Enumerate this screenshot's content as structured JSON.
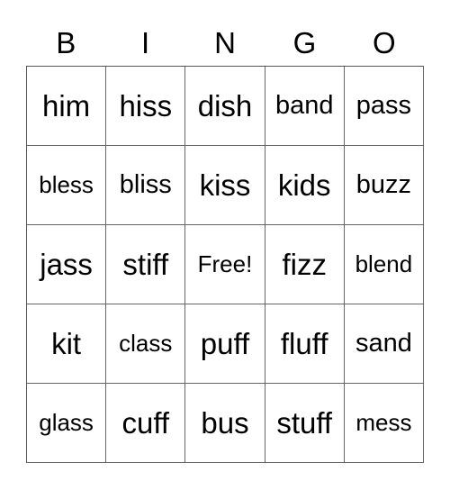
{
  "header": [
    "B",
    "I",
    "N",
    "G",
    "O"
  ],
  "cells": [
    [
      "him",
      "hiss",
      "dish",
      "band",
      "pass"
    ],
    [
      "bless",
      "bliss",
      "kiss",
      "kids",
      "buzz"
    ],
    [
      "jass",
      "stiff",
      "Free!",
      "fizz",
      "blend"
    ],
    [
      "kit",
      "class",
      "puff",
      "fluff",
      "sand"
    ],
    [
      "glass",
      "cuff",
      "bus",
      "stuff",
      "mess"
    ]
  ]
}
